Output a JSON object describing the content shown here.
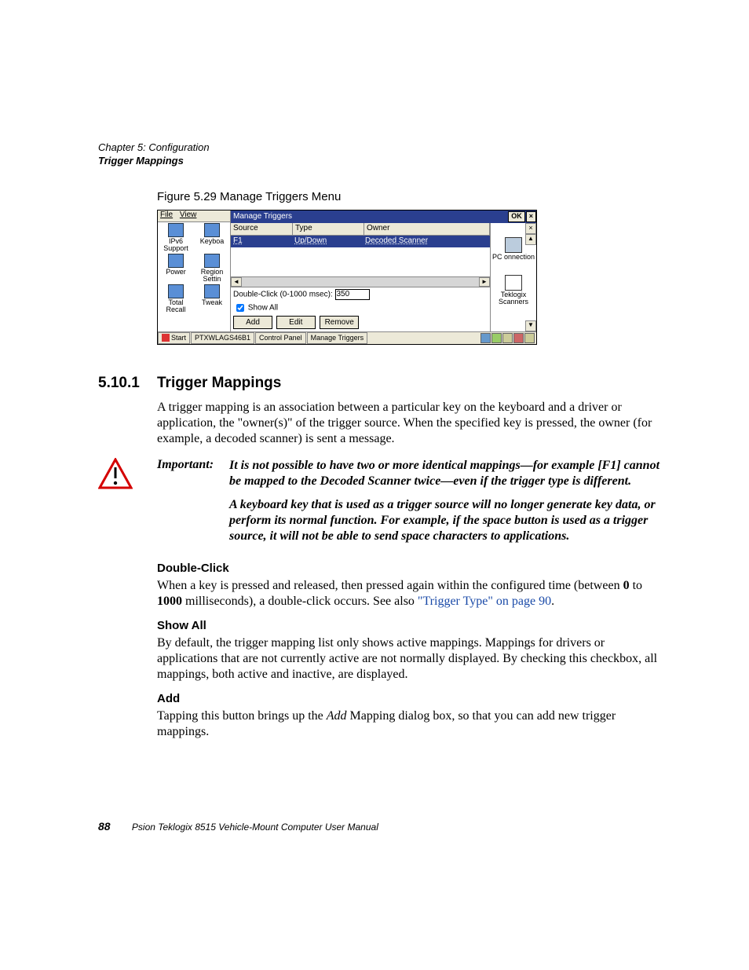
{
  "header": {
    "chapter": "Chapter 5: Configuration",
    "section": "Trigger Mappings"
  },
  "figure_caption": "Figure 5.29 Manage Triggers Menu",
  "screenshot": {
    "menubar": {
      "file": "File",
      "view": "View"
    },
    "titlebar": {
      "title": "Manage Triggers",
      "ok": "OK",
      "close": "×"
    },
    "grid": {
      "col_source": "Source",
      "col_type": "Type",
      "col_owner": "Owner",
      "row": {
        "source": "F1",
        "type": "Up/Down",
        "owner": "Decoded Scanner"
      }
    },
    "double_click_label": "Double-Click (0-1000 msec):",
    "double_click_value": "350",
    "show_all_label": "Show All",
    "buttons": {
      "add": "Add",
      "edit": "Edit",
      "remove": "Remove"
    },
    "desktop_icons": {
      "ipv6": "IPv6 Support",
      "keyboard": "Keyboa",
      "power": "Power",
      "region": "Region Settin",
      "total_recall": "Total Recall",
      "tweak": "Tweak"
    },
    "right_panel": {
      "close": "×",
      "pc": "PC onnection",
      "teklogix": "Teklogix Scanners"
    },
    "taskbar": {
      "start": "Start",
      "item1": "PTXWLAGS46B1",
      "item2": "Control Panel",
      "item3": "Manage Triggers"
    }
  },
  "section": {
    "number": "5.10.1",
    "title": "Trigger Mappings",
    "intro": "A trigger mapping is an association between a particular key on the keyboard and a driver or application, the \"owner(s)\" of the trigger source. When the specified key is pressed, the owner (for example, a decoded scanner) is sent a message."
  },
  "important": {
    "label": "Important:",
    "p1": "It is not possible to have two or more identical mappings—for example [F1] cannot be mapped to the Decoded Scanner twice—even if the trigger type is different.",
    "p2": "A keyboard key that is used as a trigger source will no longer generate key data, or perform its normal function. For example, if the space button is used as a trigger source, it will not be able to send space characters to applications."
  },
  "double_click": {
    "head": "Double-Click",
    "text_a": "When a key is pressed and released, then pressed again within the configured time (between ",
    "b0": "0",
    "text_b": " to ",
    "b1000": "1000",
    "text_c": " milliseconds), a double-click occurs. See also ",
    "link": "\"Trigger Type\" on page 90",
    "text_d": "."
  },
  "show_all": {
    "head": "Show All",
    "text": "By default, the trigger mapping list only shows active mappings. Mappings for drivers or applications that are not currently active are not normally displayed. By checking this checkbox, all mappings, both active and inactive, are displayed."
  },
  "add": {
    "head": "Add",
    "text_a": "Tapping this button brings up the ",
    "i": "Add",
    "text_b": " Mapping dialog box, so that you can add new trigger mappings."
  },
  "footer": {
    "page": "88",
    "manual": "Psion Teklogix 8515 Vehicle-Mount Computer User Manual"
  }
}
